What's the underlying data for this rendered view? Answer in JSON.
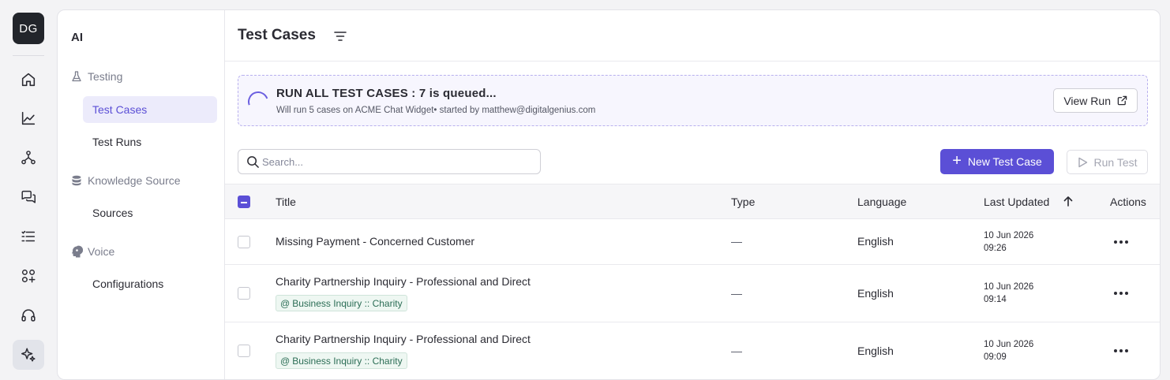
{
  "user": {
    "initials": "DG"
  },
  "rail": {
    "items": [
      "home-icon",
      "chart-line-icon",
      "network-icon",
      "chat-icon",
      "list-check-icon",
      "apps-icon",
      "headset-icon",
      "sparkles-icon"
    ]
  },
  "subnav": {
    "title": "AI",
    "sections": [
      {
        "label": "Testing",
        "icon": "flask-icon",
        "items": [
          "Test Cases",
          "Test Runs"
        ]
      },
      {
        "label": "Knowledge Source",
        "icon": "database-icon",
        "items": [
          "Sources"
        ]
      },
      {
        "label": "Voice",
        "icon": "head-voice-icon",
        "items": [
          "Configurations"
        ]
      }
    ],
    "active_item": "Test Cases"
  },
  "header": {
    "title": "Test Cases"
  },
  "banner": {
    "title": "RUN ALL TEST CASES : 7 is queued...",
    "subtitle": "Will run 5 cases on ACME Chat Widget• started by matthew@digitalgenius.com",
    "button": "View Run"
  },
  "toolbar": {
    "search_placeholder": "Search...",
    "new_button": "New Test Case",
    "run_button": "Run Test"
  },
  "table": {
    "columns": [
      "Title",
      "Type",
      "Language",
      "Last Updated",
      "Actions"
    ],
    "sort": {
      "column": "Last Updated",
      "direction": "ascending"
    },
    "rows": [
      {
        "title": "Missing Payment - Concerned Customer",
        "tag": "",
        "type": "—",
        "language": "English",
        "date": "10 Jun 2026",
        "time": "09:26"
      },
      {
        "title": "Charity Partnership Inquiry - Professional and Direct",
        "tag": "Business Inquiry :: Charity",
        "type": "—",
        "language": "English",
        "date": "10 Jun 2026",
        "time": "09:14"
      },
      {
        "title": "Charity Partnership Inquiry - Professional and Direct",
        "tag": "Business Inquiry :: Charity",
        "type": "—",
        "language": "English",
        "date": "10 Jun 2026",
        "time": "09:09"
      }
    ]
  },
  "colors": {
    "accent": "#5b4fd6",
    "active_nav_bg": "#ecebfb",
    "tag_text": "#2b6d55",
    "tag_bg": "#eef7f2"
  }
}
